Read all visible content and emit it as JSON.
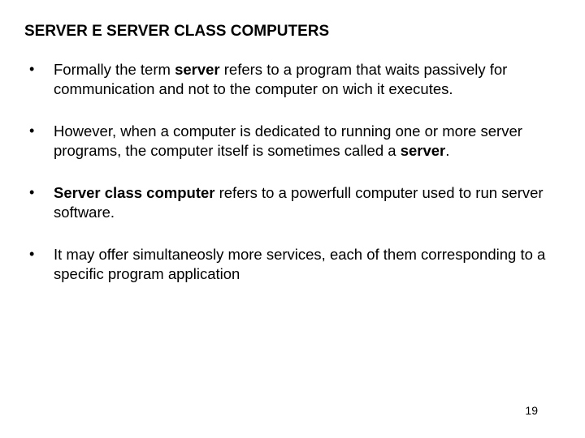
{
  "title": "SERVER E SERVER CLASS COMPUTERS",
  "bullets": {
    "b1": {
      "t1": "Formally the term ",
      "t2": "server",
      "t3": " refers to a program that waits passively for communication and not to the computer on wich it executes."
    },
    "b2": {
      "t1": "However, when a computer is dedicated to running one or more server programs, the computer itself is sometimes called a ",
      "t2": "server",
      "t3": "."
    },
    "b3": {
      "t1": "Server class computer",
      "t2": " refers to a powerfull computer used to run server software."
    },
    "b4": {
      "t1": "It may offer simultaneosly more services, each of them corresponding to a specific program application"
    }
  },
  "page_number": "19"
}
